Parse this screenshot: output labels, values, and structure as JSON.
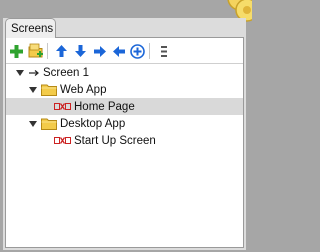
{
  "panel": {
    "tab_label": "Screens"
  },
  "toolbar": {
    "buttons": [
      {
        "name": "add-screen-button",
        "icon": "plus-icon"
      },
      {
        "name": "add-folder-button",
        "icon": "add-folder-icon"
      },
      {
        "name": "move-up-button",
        "icon": "arrow-up-icon"
      },
      {
        "name": "move-down-button",
        "icon": "arrow-down-icon"
      },
      {
        "name": "move-right-button",
        "icon": "arrow-right-icon"
      },
      {
        "name": "move-left-button",
        "icon": "arrow-left-icon"
      },
      {
        "name": "expand-all-button",
        "icon": "circle-plus-icon"
      },
      {
        "name": "options-button",
        "icon": "grip-icon"
      }
    ]
  },
  "tree": {
    "root": {
      "label": "Screen 1",
      "expanded": true
    },
    "items": [
      {
        "label": "Web App",
        "type": "folder",
        "expanded": true
      },
      {
        "label": "Home Page",
        "type": "screen",
        "selected": true
      },
      {
        "label": "Desktop App",
        "type": "folder",
        "expanded": true
      },
      {
        "label": "Start Up Screen",
        "type": "screen",
        "selected": false
      }
    ]
  },
  "colors": {
    "background": "#a6a6a6",
    "selected_row": "#d9d9d9",
    "arrow_blue": "#1b66d8",
    "add_green": "#2fa32f",
    "folder_yellow": "#f3cb4a"
  }
}
